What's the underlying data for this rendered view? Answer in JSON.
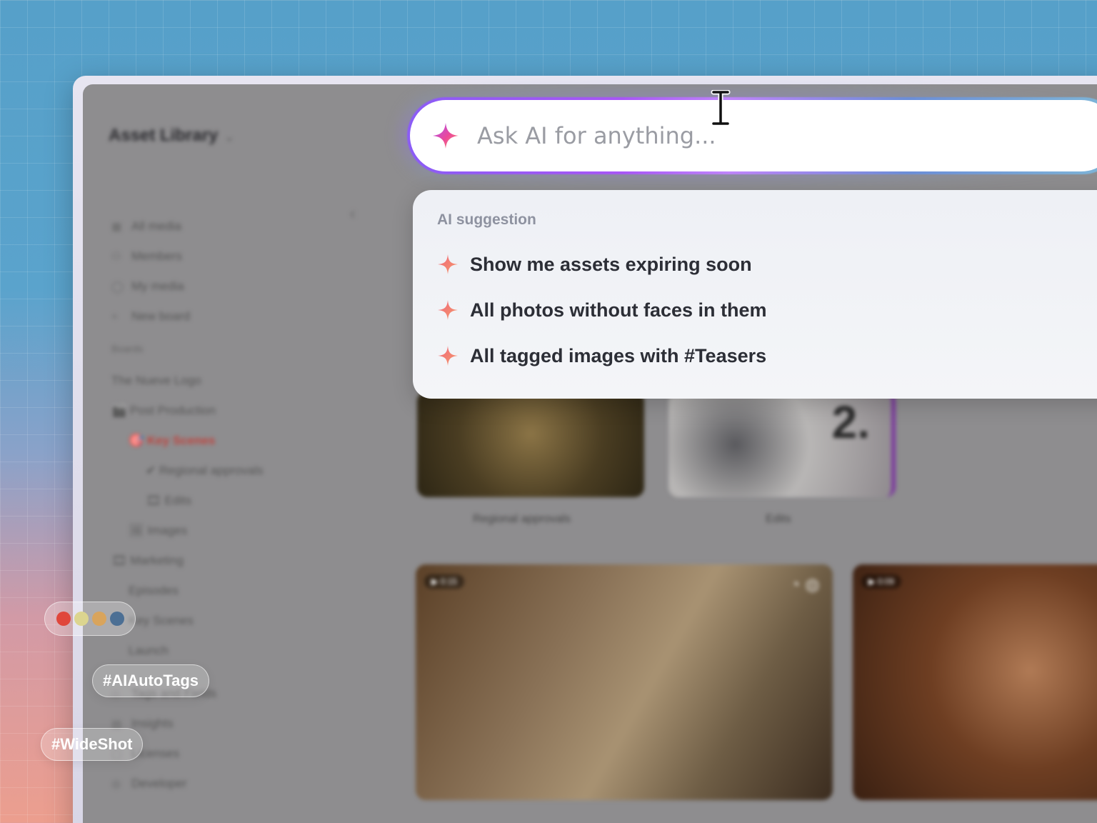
{
  "app": {
    "title": "Asset Library"
  },
  "sidebar": {
    "items": [
      {
        "label": "All media",
        "icon": "grid-icon"
      },
      {
        "label": "Members",
        "icon": "user-icon"
      },
      {
        "label": "My media",
        "icon": "circle-icon"
      },
      {
        "label": "New board",
        "icon": "plus-icon"
      }
    ],
    "boards_label": "Boards",
    "boards": [
      {
        "label": "The Nueve Logo",
        "level": 0
      },
      {
        "label": "Post Production",
        "level": 0,
        "emoji": "🎬"
      },
      {
        "label": "Key Scenes",
        "level": 1,
        "emoji": "🎯",
        "active": true
      },
      {
        "label": "Regional approvals",
        "level": 2,
        "emoji": "✔"
      },
      {
        "label": "Edits",
        "level": 2,
        "emoji": "🎞"
      },
      {
        "label": "Images",
        "level": 1,
        "emoji": "🖼"
      },
      {
        "label": "Marketing",
        "level": 0,
        "emoji": "🎞"
      },
      {
        "label": "Episodes",
        "level": 1
      },
      {
        "label": "Key Scenes",
        "level": 1
      },
      {
        "label": "Launch",
        "level": 1
      }
    ],
    "footer_items": [
      {
        "label": "Tags and Fields",
        "icon": "tag-icon"
      },
      {
        "label": "Insights",
        "icon": "chart-icon"
      },
      {
        "label": "Licenses",
        "icon": "license-icon"
      },
      {
        "label": "Developer",
        "icon": "code-icon"
      }
    ]
  },
  "content": {
    "folders": [
      {
        "label": "Regional approvals"
      },
      {
        "label": "Edits"
      }
    ],
    "clock_number": "2.",
    "videos": [
      {
        "duration": "0:15"
      },
      {
        "duration": "0:09"
      }
    ]
  },
  "search": {
    "placeholder": "Ask AI for anything...",
    "value": ""
  },
  "suggestions": {
    "heading": "AI suggestion",
    "items": [
      "Show me assets expiring soon",
      "All photos without faces in them",
      "All tagged images with #Teasers"
    ]
  },
  "overlay": {
    "swatch_colors": [
      "#e0463b",
      "#dcd58f",
      "#d9a45c",
      "#4c6f94"
    ],
    "tags": [
      "#AIAutoTags",
      "#WideShot"
    ]
  },
  "colors": {
    "accent_purple": "#a855f7",
    "sparkle_pink": "#f0657a",
    "sparkle_orange": "#f59a6b"
  }
}
